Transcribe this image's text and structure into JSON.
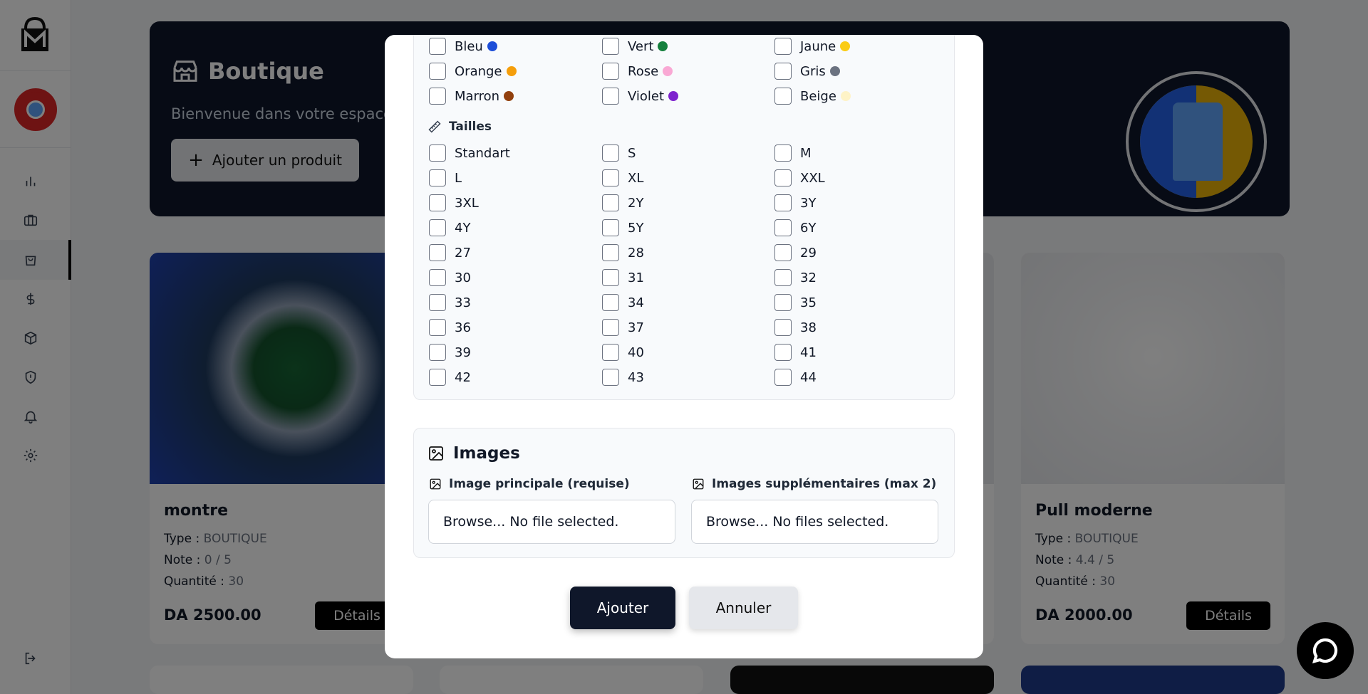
{
  "banner": {
    "title": "Boutique",
    "subtitle": "Bienvenue dans votre espace c",
    "add_button": "Ajouter un produit"
  },
  "products": [
    {
      "name": "montre",
      "type_label": "Type :",
      "type": "BOUTIQUE",
      "note_label": "Note :",
      "note": "0 / 5",
      "qty_label": "Quantité :",
      "qty": "30",
      "price": "DA 2500.00",
      "details": "Détails"
    },
    {
      "name": "Pull moderne",
      "type_label": "Type :",
      "type": "BOUTIQUE",
      "note_label": "Note :",
      "note": "4.4 / 5",
      "qty_label": "Quantité :",
      "qty": "30",
      "price": "DA 2000.00",
      "details": "Détails"
    }
  ],
  "modal": {
    "colors": [
      {
        "label": "Bleu",
        "hex": "#1d4ed8"
      },
      {
        "label": "Vert",
        "hex": "#15803d"
      },
      {
        "label": "Jaune",
        "hex": "#facc15"
      },
      {
        "label": "Orange",
        "hex": "#f59e0b"
      },
      {
        "label": "Rose",
        "hex": "#f9a8d4"
      },
      {
        "label": "Gris",
        "hex": "#6b7280"
      },
      {
        "label": "Marron",
        "hex": "#92400e"
      },
      {
        "label": "Violet",
        "hex": "#7e22ce"
      },
      {
        "label": "Beige",
        "hex": "#fef3c7"
      }
    ],
    "sizes_title": "Tailles",
    "sizes": [
      "Standart",
      "S",
      "M",
      "L",
      "XL",
      "XXL",
      "3XL",
      "2Y",
      "3Y",
      "4Y",
      "5Y",
      "6Y",
      "27",
      "28",
      "29",
      "30",
      "31",
      "32",
      "33",
      "34",
      "35",
      "36",
      "37",
      "38",
      "39",
      "40",
      "41",
      "42",
      "43",
      "44"
    ],
    "images_title": "Images",
    "main_image_label": "Image principale (requise)",
    "main_image_value": "Browse... No file selected.",
    "extra_images_label": "Images supplémentaires (max 2)",
    "extra_images_value": "Browse... No files selected.",
    "submit": "Ajouter",
    "cancel": "Annuler"
  }
}
